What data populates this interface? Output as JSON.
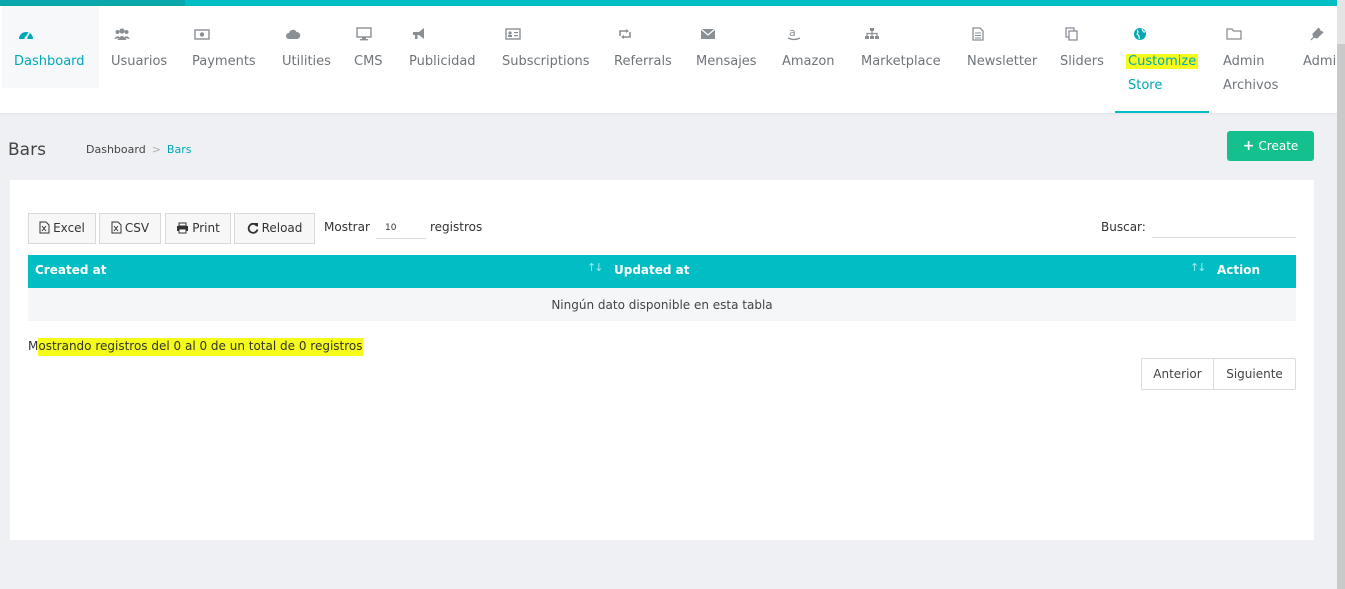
{
  "nav": {
    "items": [
      {
        "label": "Dashboard",
        "icon": "dashboard-icon"
      },
      {
        "label": "Usuarios",
        "icon": "users-icon"
      },
      {
        "label": "Payments",
        "icon": "money-icon"
      },
      {
        "label": "Utilities",
        "icon": "cloud-icon"
      },
      {
        "label": "CMS",
        "icon": "desktop-icon"
      },
      {
        "label": "Publicidad",
        "icon": "megaphone-icon"
      },
      {
        "label": "Subscriptions",
        "icon": "id-card-icon"
      },
      {
        "label": "Referrals",
        "icon": "retweet-icon"
      },
      {
        "label": "Mensajes",
        "icon": "envelope-icon"
      },
      {
        "label": "Amazon",
        "icon": "amazon-icon"
      },
      {
        "label": "Marketplace",
        "icon": "sitemap-icon"
      },
      {
        "label": "Newsletter",
        "icon": "document-icon"
      },
      {
        "label": "Sliders",
        "icon": "copy-icon"
      },
      {
        "label": "Customize",
        "label2": "Store",
        "icon": "globe-icon"
      },
      {
        "label": "Admin",
        "label2": "Archivos",
        "icon": "folder-icon"
      },
      {
        "label": "Admi",
        "icon": "plug-icon"
      }
    ]
  },
  "page": {
    "title": "Bars",
    "breadcrumb": [
      "Dashboard",
      "Bars"
    ],
    "create_label": "Create"
  },
  "toolbar": {
    "excel": "Excel",
    "csv": "CSV",
    "print": "Print",
    "reload": "Reload",
    "show_label": "Mostrar",
    "page_length": "10",
    "records_label": "registros",
    "search_label": "Buscar:"
  },
  "table": {
    "columns": [
      "Created at",
      "Updated at",
      "Action"
    ],
    "empty_message": "Ningún dato disponible en esta tabla"
  },
  "footer": {
    "info_first": "M",
    "info_rest": "ostrando registros del 0 al 0 de un total de 0 registros",
    "prev": "Anterior",
    "next": "Siguiente"
  },
  "colors": {
    "accent": "#00bec4",
    "active_text": "#00a8b5",
    "create_button": "#14c08e",
    "highlight": "#f5fc1b"
  }
}
